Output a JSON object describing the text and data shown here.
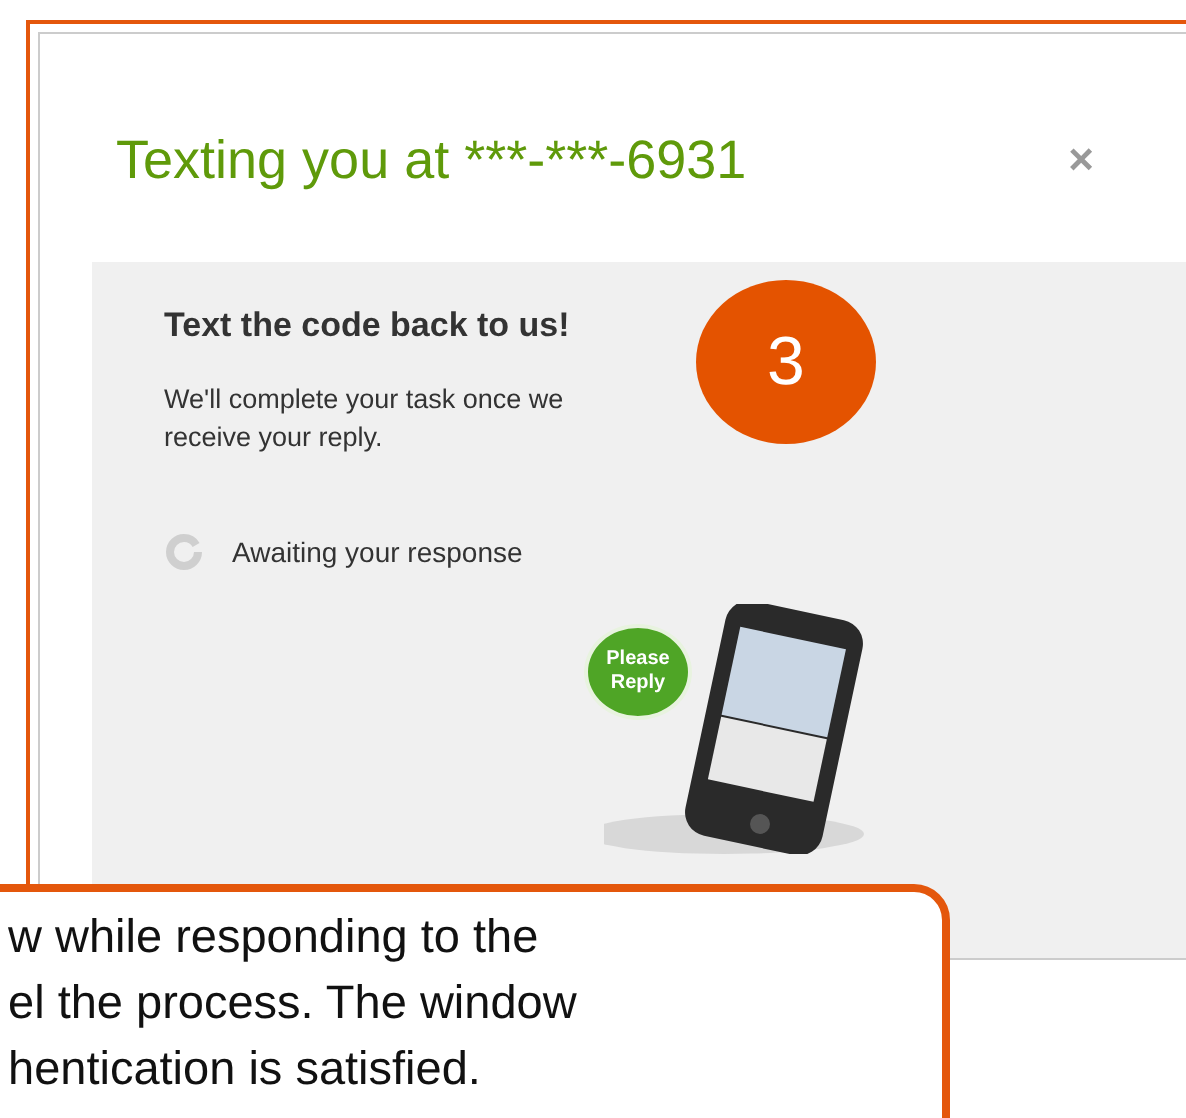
{
  "dialog": {
    "title": "Texting you at ***-***-6931",
    "close": "×"
  },
  "panel": {
    "heading": "Text the code back to us!",
    "body": "We'll complete your task once we receive your reply.",
    "status": "Awaiting your response",
    "bubble": "Please Reply"
  },
  "badge": "3",
  "callout": {
    "lines": [
      "w while responding to the",
      "el the process. The window",
      "hentication is satisfied."
    ]
  }
}
